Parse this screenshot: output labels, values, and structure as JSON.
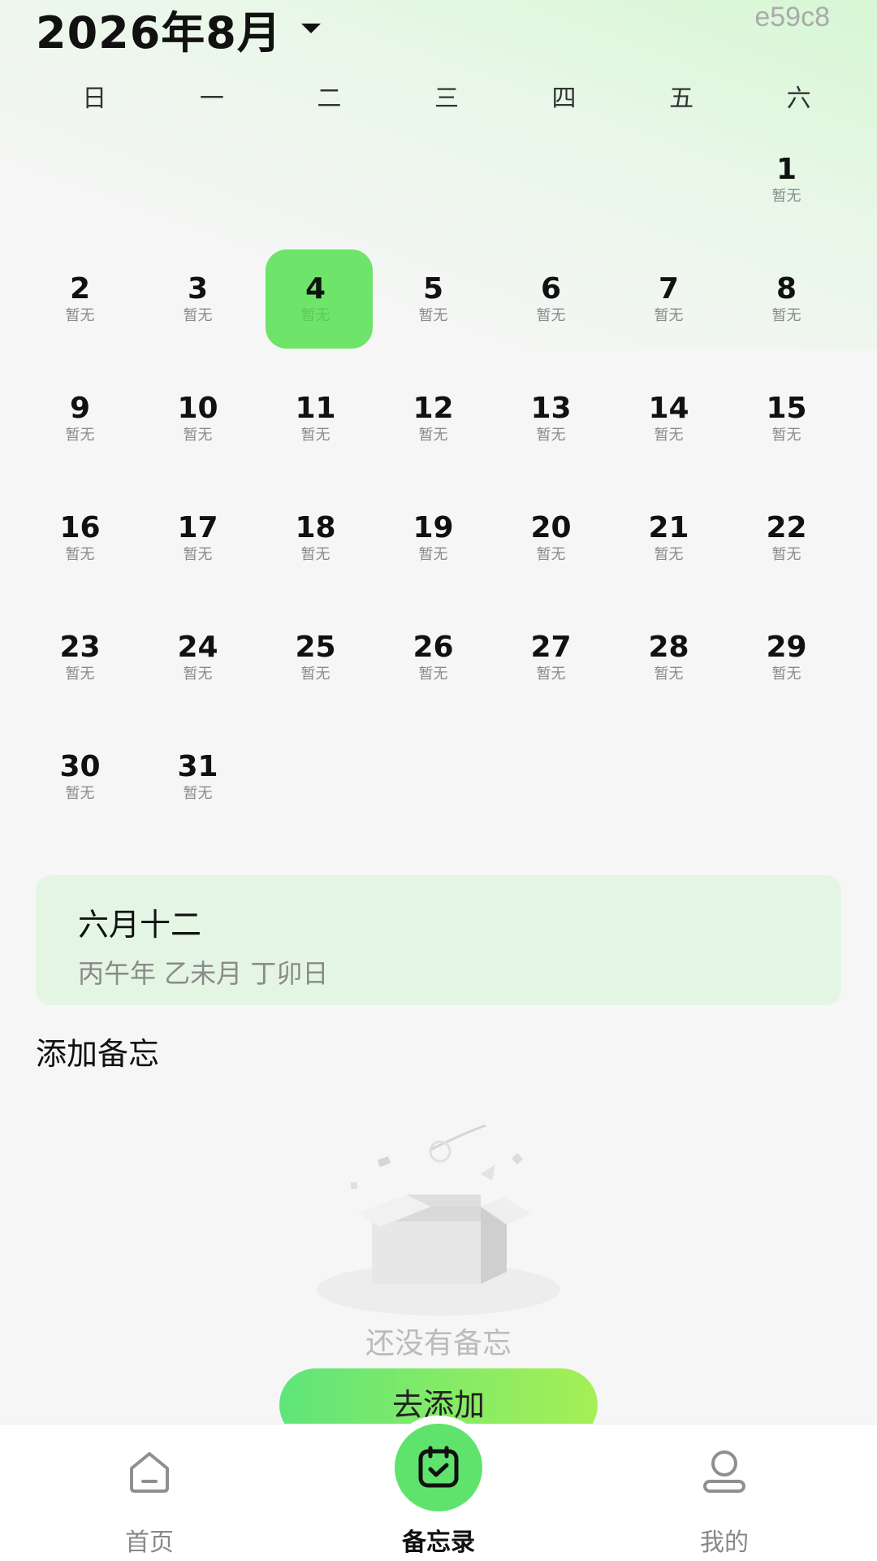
{
  "header": {
    "title": "2026年8月",
    "tag": "e59c8"
  },
  "weekdays": [
    "日",
    "一",
    "二",
    "三",
    "四",
    "五",
    "六"
  ],
  "calendar": {
    "empty_label": "暂无",
    "selected_day": 4,
    "weeks": [
      [
        "",
        "",
        "",
        "",
        "",
        "",
        "1"
      ],
      [
        "2",
        "3",
        "4",
        "5",
        "6",
        "7",
        "8"
      ],
      [
        "9",
        "10",
        "11",
        "12",
        "13",
        "14",
        "15"
      ],
      [
        "16",
        "17",
        "18",
        "19",
        "20",
        "21",
        "22"
      ],
      [
        "23",
        "24",
        "25",
        "26",
        "27",
        "28",
        "29"
      ],
      [
        "30",
        "31",
        "",
        "",
        "",
        "",
        ""
      ]
    ]
  },
  "lunar": {
    "date": "六月十二",
    "ganzhi": "丙午年 乙未月 丁卯日"
  },
  "memo": {
    "section_title": "添加备忘",
    "empty_text": "还没有备忘",
    "add_button": "去添加"
  },
  "tabbar": {
    "home": "首页",
    "memo": "备忘录",
    "mine": "我的"
  },
  "colors": {
    "accent": "#6ee46a",
    "lunar_bg": "#e4f6e3"
  }
}
